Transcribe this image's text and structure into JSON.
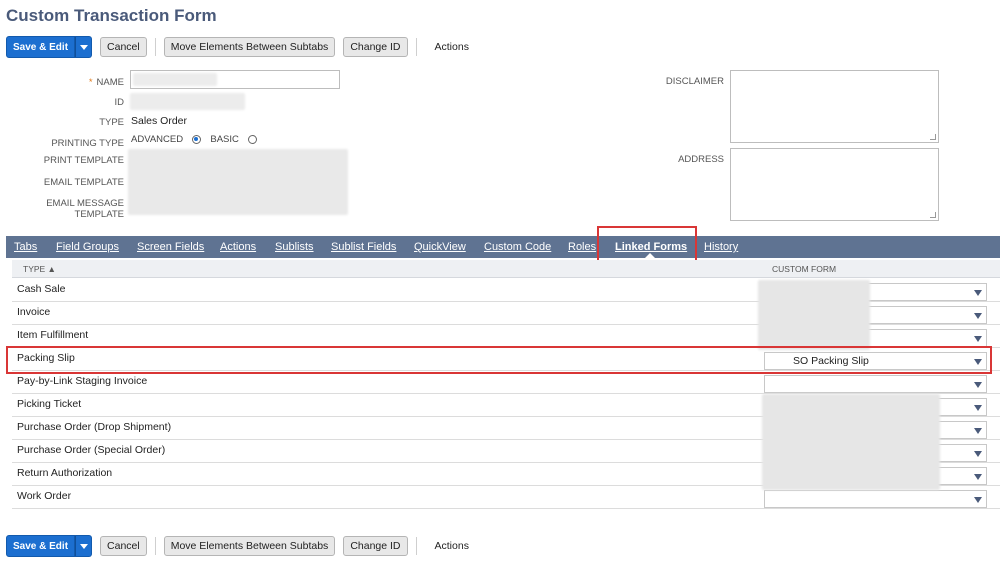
{
  "page_title": "Custom Transaction Form",
  "toolbar": {
    "save_edit": "Save & Edit",
    "cancel": "Cancel",
    "move_elements": "Move Elements Between Subtabs",
    "change_id": "Change ID",
    "actions": "Actions"
  },
  "form": {
    "name_label": "NAME",
    "id_label": "ID",
    "type_label": "TYPE",
    "type_value": "Sales Order",
    "printing_type_label": "PRINTING TYPE",
    "printing_advanced": "ADVANCED",
    "printing_basic": "BASIC",
    "printing_selected": "ADVANCED",
    "print_template_label": "PRINT TEMPLATE",
    "email_template_label": "EMAIL TEMPLATE",
    "email_message_template_label": "EMAIL MESSAGE TEMPLATE",
    "disclaimer_label": "DISCLAIMER",
    "address_label": "ADDRESS"
  },
  "tabs": [
    "Tabs",
    "Field Groups",
    "Screen Fields",
    "Actions",
    "Sublists",
    "Sublist Fields",
    "QuickView",
    "Custom Code",
    "Roles",
    "Linked Forms",
    "History"
  ],
  "active_tab": "Linked Forms",
  "table": {
    "col_type": "TYPE ▲",
    "col_custom_form": "CUSTOM FORM",
    "rows": [
      {
        "type": "Cash Sale",
        "custom_form": ""
      },
      {
        "type": "Invoice",
        "custom_form": ""
      },
      {
        "type": "Item Fulfillment",
        "custom_form": ""
      },
      {
        "type": "Packing Slip",
        "custom_form": "SO Packing Slip"
      },
      {
        "type": "Pay-by-Link Staging Invoice",
        "custom_form": ""
      },
      {
        "type": "Picking Ticket",
        "custom_form": ""
      },
      {
        "type": "Purchase Order (Drop Shipment)",
        "custom_form": ""
      },
      {
        "type": "Purchase Order (Special Order)",
        "custom_form": ""
      },
      {
        "type": "Return Authorization",
        "custom_form": ""
      },
      {
        "type": "Work Order",
        "custom_form": ""
      }
    ]
  },
  "colors": {
    "primary": "#1c6fd0",
    "tabbar": "#5f7392",
    "title": "#4a5a7a",
    "highlight": "#d93636"
  }
}
